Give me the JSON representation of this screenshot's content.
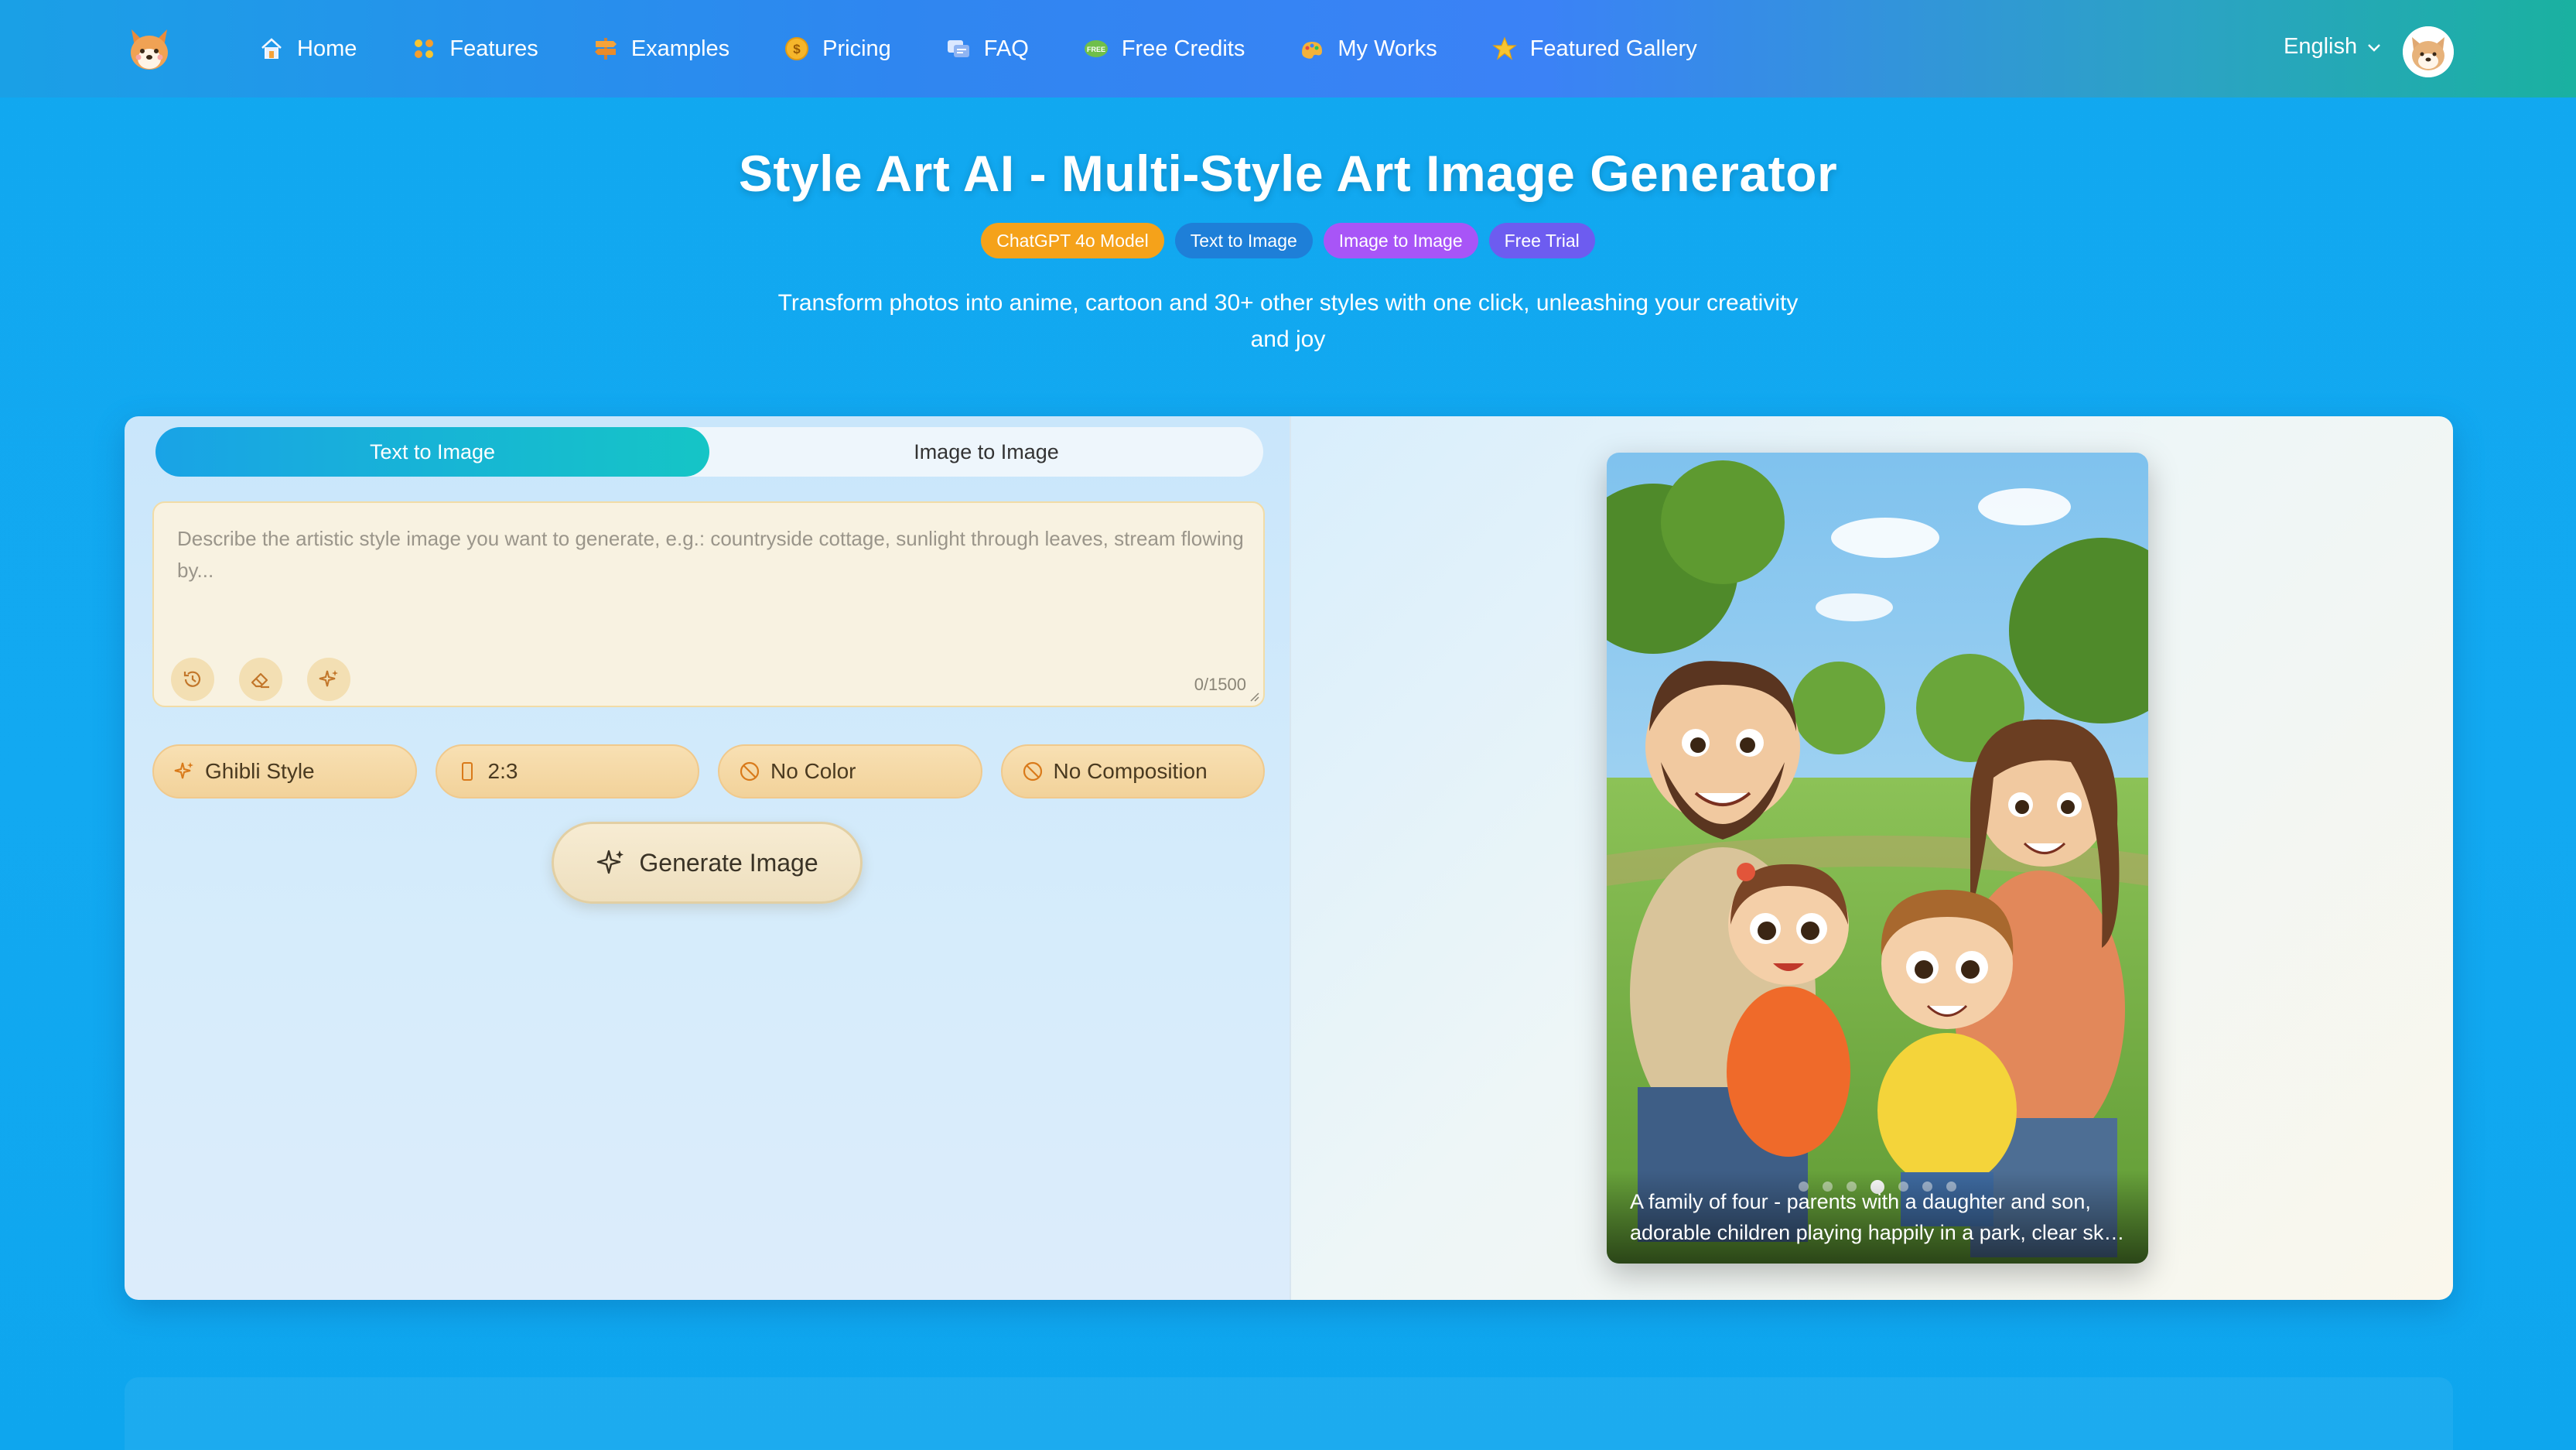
{
  "nav": {
    "logo": "shiba-logo-icon",
    "items": [
      {
        "label": "Home",
        "icon": "home-icon"
      },
      {
        "label": "Features",
        "icon": "grid-icon"
      },
      {
        "label": "Examples",
        "icon": "signpost-icon"
      },
      {
        "label": "Pricing",
        "icon": "coin-icon"
      },
      {
        "label": "FAQ",
        "icon": "faq-icon"
      },
      {
        "label": "Free Credits",
        "icon": "free-tag-icon"
      },
      {
        "label": "My Works",
        "icon": "palette-icon"
      },
      {
        "label": "Featured Gallery",
        "icon": "star-icon"
      }
    ],
    "language": "English"
  },
  "hero": {
    "title": "Style Art AI - Multi-Style Art Image Generator",
    "badges": [
      "ChatGPT 4o Model",
      "Text to Image",
      "Image to Image",
      "Free Trial"
    ],
    "subtitle": "Transform photos into anime, cartoon and 30+ other styles with one click, unleashing your creativity and joy"
  },
  "generator": {
    "tabs": [
      "Text to Image",
      "Image to Image"
    ],
    "active_tab": "Text to Image",
    "prompt": {
      "value": "",
      "placeholder": "Describe the artistic style image you want to generate, e.g.: countryside cottage, sunlight through leaves, stream flowing by...",
      "counter": "0/1500"
    },
    "options": {
      "style": "Ghibli Style",
      "ratio": "2:3",
      "color": "No Color",
      "composition": "No Composition"
    },
    "generate_label": "Generate Image"
  },
  "preview": {
    "caption": "A family of four - parents with a daughter and son, adorable children playing happily in a park, clear sky with fluffy clouds",
    "slide_count": 7,
    "active_slide": 4
  },
  "colors": {
    "page_bg": "#12a9f1",
    "active_tab": "#19a3e6",
    "badge_orange": "#f5a21a",
    "badge_blue": "#1e7fd8",
    "badge_purple": "#a855f7",
    "badge_indigo": "#6d5cf0",
    "option_bg": "#f2d29a"
  }
}
